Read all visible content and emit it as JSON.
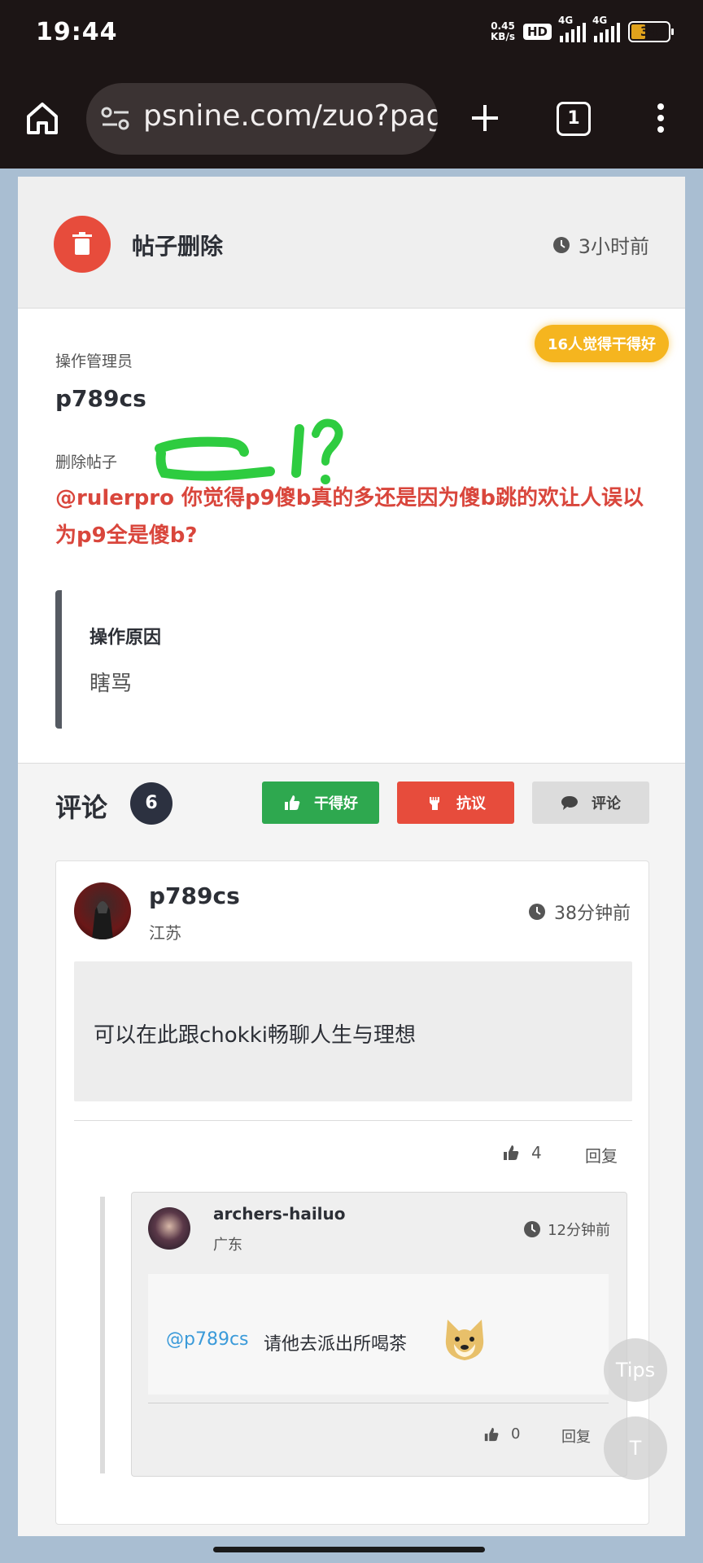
{
  "statusbar": {
    "time": "19:44",
    "speed_value": "0.45",
    "speed_unit": "KB/s",
    "hd_label": "HD",
    "net1": "4G",
    "net2": "4G",
    "battery": "34"
  },
  "browser": {
    "url": "psnine.com/zuo?page",
    "tab_count": "1"
  },
  "post": {
    "type_title": "帖子删除",
    "time": "3小时前",
    "good_badge": "16人觉得干得好",
    "admin_label": "操作管理员",
    "admin_name": "p789cs",
    "deleted_label": "删除帖子",
    "deleted_content": "@rulerpro 你觉得p9傻b真的多还是因为傻b跳的欢让人误以为p9全是傻b?",
    "reason_title": "操作原因",
    "reason_text": "瞎骂"
  },
  "comments": {
    "title": "评论",
    "count": "6",
    "btn_good": "干得好",
    "btn_protest": "抗议",
    "btn_comment": "评论",
    "items": [
      {
        "name": "p789cs",
        "location": "江苏",
        "time": "38分钟前",
        "text": "可以在此跟chokki畅聊人生与理想",
        "likes": "4",
        "reply_label": "回复",
        "replies": [
          {
            "name": "archers-hailuo",
            "location": "广东",
            "time": "12分钟前",
            "mention": "@p789cs",
            "text": "请他去派出所喝茶",
            "likes": "0",
            "reply_label": "回复"
          }
        ]
      }
    ]
  },
  "floating": {
    "tips": "Tips",
    "t": "T"
  },
  "colors": {
    "danger": "#e74c3c",
    "success": "#2ea84f",
    "badge": "#f5b51f",
    "link": "#3a9ad9"
  },
  "icons": [
    "home-icon",
    "site-settings-icon",
    "plus-icon",
    "tabs-icon",
    "more-icon",
    "trash-icon",
    "clock-icon",
    "thumbs-up-icon",
    "fist-icon",
    "comment-icon",
    "doge-emoji-icon"
  ]
}
